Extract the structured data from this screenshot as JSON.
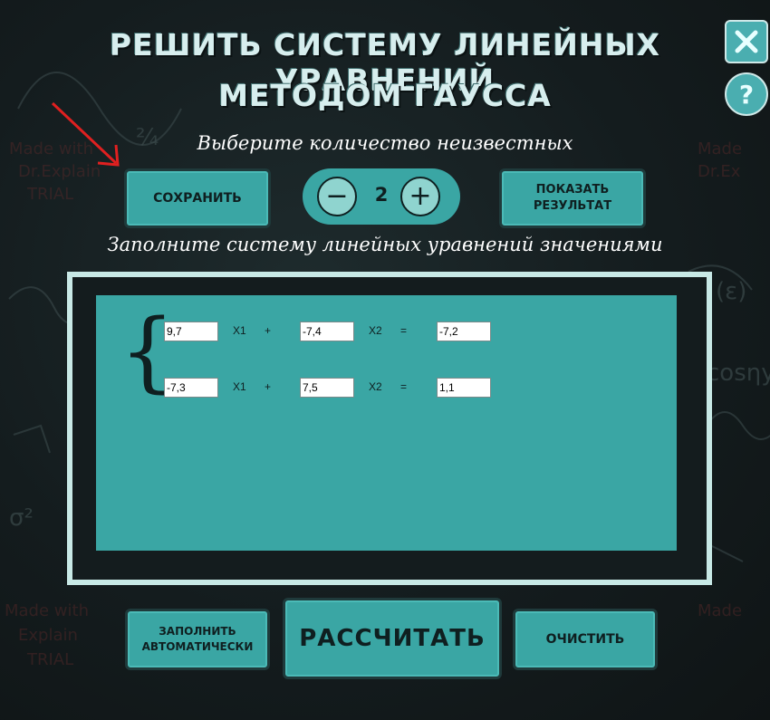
{
  "title": {
    "line1": "РЕШИТЬ СИСТЕМУ ЛИНЕЙНЫХ УРАВНЕНИЙ",
    "line2": "МЕТОДОМ ГАУССА"
  },
  "window_controls": {
    "close_icon": "close-icon",
    "help_icon": "help-icon",
    "help_glyph": "?"
  },
  "hint_count": "Выберите количество неизвестных",
  "hint_fill": "Заполните систему линейных уравнений значениями",
  "buttons": {
    "save": "СОХРАНИТЬ",
    "show_result_1": "ПОКАЗАТЬ",
    "show_result_2": "РЕЗУЛЬТАТ",
    "fill_auto_1": "ЗАПОЛНИТЬ",
    "fill_auto_2": "АВТОМАТИЧЕСКИ",
    "calculate": "РАССЧИТАТЬ",
    "clear": "ОЧИСТИТЬ"
  },
  "stepper": {
    "minus": "−",
    "plus": "+",
    "value": "2"
  },
  "equations": [
    {
      "a1": "9,7",
      "x1": "X1",
      "op": "+",
      "a2": "-7,4",
      "x2": "X2",
      "eq": "=",
      "b": "-7,2"
    },
    {
      "a1": "-7,3",
      "x1": "X1",
      "op": "+",
      "a2": "7,5",
      "x2": "X2",
      "eq": "=",
      "b": "1,1"
    }
  ],
  "colors": {
    "accent": "#3aa6a4",
    "annotation_arrow": "#e02020"
  }
}
